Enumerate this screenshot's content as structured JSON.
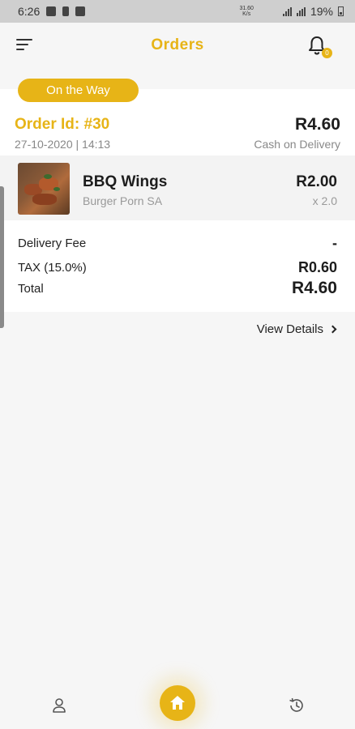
{
  "status_bar": {
    "time": "6:26",
    "net_speed_top": "31.60",
    "net_speed_bottom": "K/s",
    "battery": "19%",
    "icons": [
      "gallery-icon",
      "download-icon",
      "app-icon",
      "mute-icon",
      "location-icon",
      "signal-icon",
      "lte-icon",
      "battery-icon"
    ]
  },
  "header": {
    "title": "Orders",
    "notification_count": "0"
  },
  "order": {
    "status": "On the Way",
    "id": "Order Id: #30",
    "date": "27-10-2020 | 14:13",
    "total": "R4.60",
    "payment": "Cash on Delivery",
    "items": [
      {
        "name": "BBQ Wings",
        "vendor": "Burger Porn SA",
        "price": "R2.00",
        "qty": "x 2.0"
      }
    ],
    "summary": {
      "delivery_label": "Delivery Fee",
      "delivery_value": "-",
      "tax_label": "TAX (15.0%)",
      "tax_value": "R0.60",
      "total_label": "Total",
      "total_value": "R4.60"
    },
    "view_details": "View Details"
  },
  "nav": {
    "items": [
      "profile-icon",
      "home-icon",
      "history-icon"
    ]
  },
  "colors": {
    "accent": "#e7b417",
    "background": "#f6f6f6",
    "card": "#ffffff"
  }
}
